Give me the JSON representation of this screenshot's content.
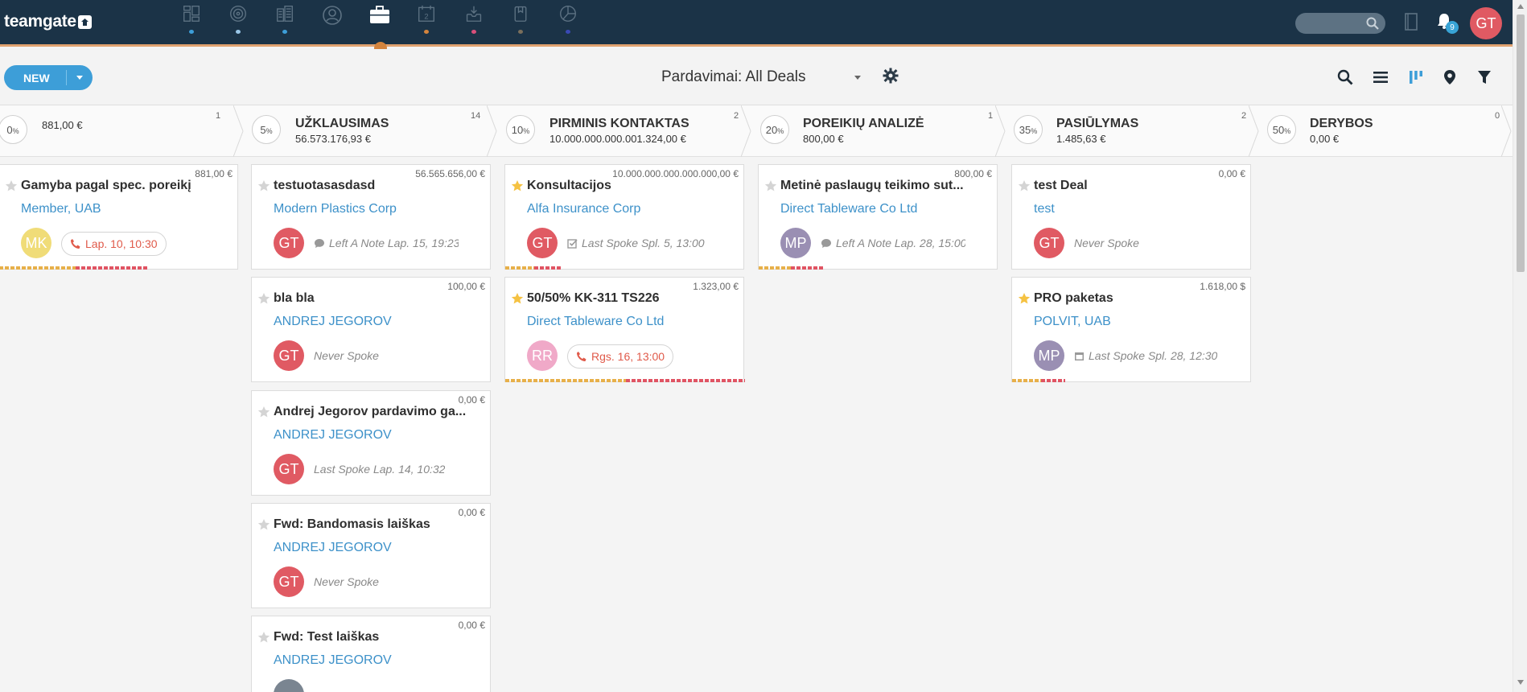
{
  "app": {
    "logo_text": "teamgate",
    "nav_icons": [
      {
        "icon": "dashboard-icon",
        "dot_color": "#3d9ed8"
      },
      {
        "icon": "target-icon",
        "dot_color": "#9ac7e8"
      },
      {
        "icon": "buildings-icon",
        "dot_color": "#3d9ed8"
      },
      {
        "icon": "contacts-icon",
        "dot_color": ""
      },
      {
        "icon": "briefcase-icon",
        "dot_color": "#d4843d"
      },
      {
        "icon": "calendar-icon",
        "dot_color": "#d4843d"
      },
      {
        "icon": "inbox-icon",
        "dot_color": "#d94f7a"
      },
      {
        "icon": "document-icon",
        "dot_color": "#7a6f5c"
      },
      {
        "icon": "pie-chart-icon",
        "dot_color": "#3a49b5"
      }
    ],
    "calendar_day": "2",
    "notification_count": "9",
    "user_initials": "GT"
  },
  "toolbar": {
    "new_label": "NEW",
    "view_title": "Pardavimai: All Deals"
  },
  "stages": [
    {
      "percent": "0",
      "name": "",
      "total": "881,00 €",
      "count": "1"
    },
    {
      "percent": "5",
      "name": "UŽKLAUSIMAS",
      "total": "56.573.176,93 €",
      "count": "14"
    },
    {
      "percent": "10",
      "name": "PIRMINIS KONTAKTAS",
      "total": "10.000.000.000.001.324,00 €",
      "count": "2"
    },
    {
      "percent": "20",
      "name": "POREIKIŲ ANALIZĖ",
      "total": "800,00 €",
      "count": "1"
    },
    {
      "percent": "35",
      "name": "PASIŪLYMAS",
      "total": "1.485,63 €",
      "count": "2"
    },
    {
      "percent": "50",
      "name": "DERYBOS",
      "total": "0,00 €",
      "count": "0"
    }
  ],
  "cards": [
    {
      "title": "Gamyba pagal spec. poreikį",
      "company": "Member, UAB",
      "amount": "881,00 €",
      "initials": "MK",
      "avatar_color": "#f0dc78",
      "activity": "Lap. 10, 10:30",
      "activity_type": "call",
      "starred": false
    },
    {
      "title": "testuotasasdasd",
      "company": "Modern Plastics Corp",
      "amount": "56.565.656,00 €",
      "initials": "GT",
      "avatar_color": "#e05a63",
      "activity": "Left A Note Lap. 15, 19:23",
      "activity_type": "note",
      "starred": false
    },
    {
      "title": "bla bla",
      "company": "ANDREJ JEGOROV",
      "amount": "100,00 €",
      "initials": "GT",
      "avatar_color": "#e05a63",
      "activity": "Never Spoke",
      "activity_type": "none",
      "starred": false
    },
    {
      "title": "Andrej Jegorov pardavimo ga...",
      "company": "ANDREJ JEGOROV",
      "amount": "0,00 €",
      "initials": "GT",
      "avatar_color": "#e05a63",
      "activity": "Last Spoke Lap. 14, 10:32",
      "activity_type": "none",
      "starred": false
    },
    {
      "title": "Fwd: Bandomasis laiškas",
      "company": "ANDREJ JEGOROV",
      "amount": "0,00 €",
      "initials": "GT",
      "avatar_color": "#e05a63",
      "activity": "Never Spoke",
      "activity_type": "none",
      "starred": false
    },
    {
      "title": "Fwd: Test laiškas",
      "company": "ANDREJ JEGOROV",
      "amount": "0,00 €",
      "initials": "",
      "avatar_color": "#7a8591",
      "activity": "",
      "activity_type": "none",
      "starred": false
    },
    {
      "title": "Konsultacijos",
      "company": "Alfa Insurance Corp",
      "amount": "10.000.000.000.000.000,00 €",
      "initials": "GT",
      "avatar_color": "#e05a63",
      "activity": "Last Spoke Spl. 5, 13:00",
      "activity_type": "task",
      "starred": true
    },
    {
      "title": "50/50% KK-311 TS226",
      "company": "Direct Tableware Co Ltd",
      "amount": "1.323,00 €",
      "initials": "RR",
      "avatar_color": "#f0a9c8",
      "activity": "Rgs. 16, 13:00",
      "activity_type": "call",
      "starred": true
    },
    {
      "title": "Metinė paslaugų teikimo sut...",
      "company": "Direct Tableware Co Ltd",
      "amount": "800,00 €",
      "initials": "MP",
      "avatar_color": "#9a8fb3",
      "activity": "Left A Note Lap. 28, 15:00",
      "activity_type": "note",
      "starred": false
    },
    {
      "title": "test Deal",
      "company": "test",
      "amount": "0,00 €",
      "initials": "GT",
      "avatar_color": "#e05a63",
      "activity": "Never Spoke",
      "activity_type": "none",
      "starred": false
    },
    {
      "title": "PRO paketas",
      "company": "POLVIT, UAB",
      "amount": "1.618,00 $",
      "initials": "MP",
      "avatar_color": "#9a8fb3",
      "activity": "Last Spoke Spl. 28, 12:30",
      "activity_type": "calendar",
      "starred": true
    }
  ]
}
